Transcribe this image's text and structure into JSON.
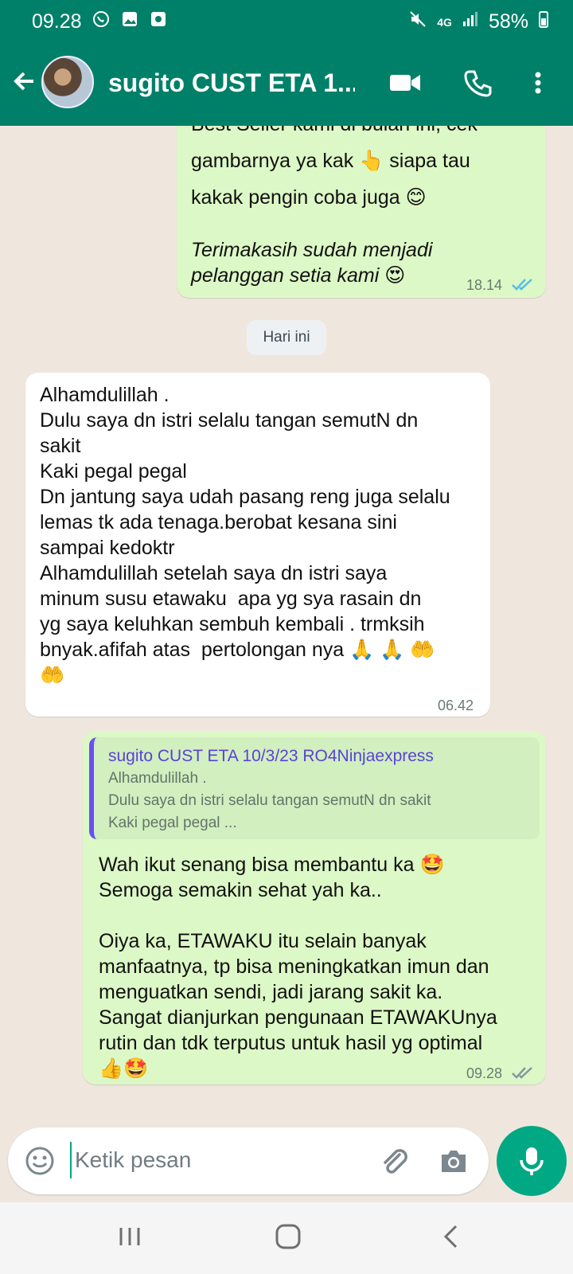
{
  "status_bar": {
    "time": "09.28",
    "battery": "58%",
    "network": "4G"
  },
  "header": {
    "title": "sugito CUST ETA 1...",
    "accent_color": "#008069"
  },
  "messages": {
    "first_out": {
      "partial_line": "Best Seller kami di bulan ini, cek",
      "line1": "gambarnya ya kak 👆  siapa tau",
      "line2": "kakak pengin coba juga 😊",
      "line3": "Terimakasih sudah menjadi",
      "line4": "pelanggan setia kami 😍",
      "time": "18.14"
    },
    "day_label": "Hari ini",
    "incoming": {
      "lines": [
        "Alhamdulillah .",
        "Dulu saya dn istri selalu tangan semutN dn",
        "sakit",
        "Kaki pegal pegal",
        "Dn jantung saya udah pasang reng juga selalu",
        "lemas tk ada tenaga.berobat kesana sini",
        "sampai kedoktr",
        "Alhamdulillah setelah saya dn istri saya",
        "minum susu etawaku  apa yg sya rasain dn",
        "yg saya keluhkan sembuh kembali . trmksih",
        "bnyak.afifah atas  pertolongan nya 🙏 🙏 🤲",
        "🤲"
      ],
      "time": "06.42"
    },
    "reply": {
      "quote_author": "sugito CUST ETA 10/3/23 RO4Ninjaexpress",
      "quote_text": "Alhamdulillah .\nDulu saya dn istri selalu tangan semutN dn sakit\nKaki pegal pegal ...",
      "lines": [
        "Wah ikut senang bisa membantu ka 🤩",
        "Semoga semakin sehat yah ka..",
        "",
        "Oiya ka, ETAWAKU itu selain banyak",
        "manfaatnya, tp bisa meningkatkan imun dan",
        "menguatkan sendi, jadi jarang sakit ka.",
        "Sangat dianjurkan pengunaan ETAWAKUnya",
        "rutin dan tdk terputus untuk hasil yg optimal",
        "👍🤩"
      ],
      "time": "09.28"
    }
  },
  "composer": {
    "placeholder": "Ketik pesan"
  },
  "icons": {
    "back": "arrow-back-icon",
    "video": "video-call-icon",
    "call": "phone-icon",
    "menu": "more-vertical-icon",
    "emoji": "emoji-icon",
    "attach": "paperclip-icon",
    "camera": "camera-icon",
    "mic": "microphone-icon"
  }
}
